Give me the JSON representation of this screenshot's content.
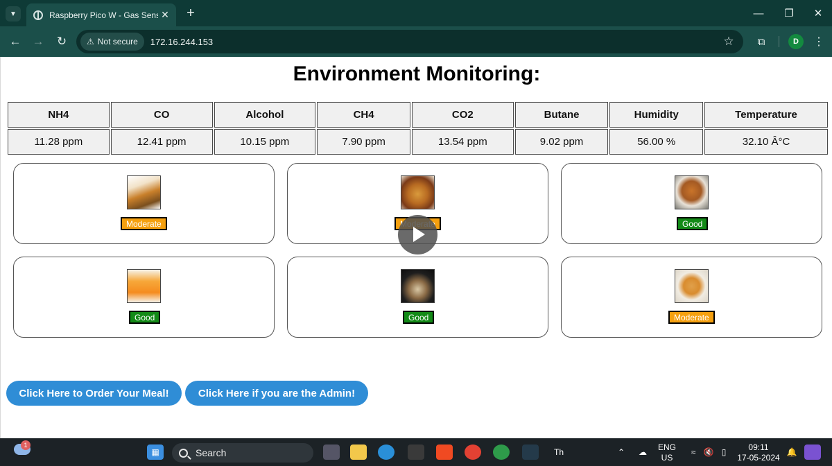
{
  "browser": {
    "tab_title": "Raspberry Pico W - Gas Sensor",
    "security_label": "Not secure",
    "url": "172.16.244.153",
    "profile_initial": "D"
  },
  "page": {
    "heading": "Environment Monitoring:",
    "table": {
      "headers": [
        "NH4",
        "CO",
        "Alcohol",
        "CH4",
        "CO2",
        "Butane",
        "Humidity",
        "Temperature"
      ],
      "values": [
        "11.28 ppm",
        "12.41 ppm",
        "10.15 ppm",
        "7.90 ppm",
        "13.54 ppm",
        "9.02 ppm",
        "56.00 %",
        "32.10 Â°C"
      ]
    },
    "cards": [
      {
        "food": "fried-snack",
        "status": "Moderate",
        "status_color": "#f5a00f"
      },
      {
        "food": "samosa",
        "status": "Moderate",
        "status_color": "#f5a00f"
      },
      {
        "food": "noodles",
        "status": "Good",
        "status_color": "#138a17"
      },
      {
        "food": "orange-juice",
        "status": "Good",
        "status_color": "#138a17"
      },
      {
        "food": "dish",
        "status": "Good",
        "status_color": "#138a17"
      },
      {
        "food": "fries",
        "status": "Moderate",
        "status_color": "#f5a00f"
      }
    ],
    "order_button": "Click Here to Order Your Meal!",
    "admin_button": "Click Here if you are the Admin!"
  },
  "taskbar": {
    "notification_count": "1",
    "search_label": "Search",
    "lang_top": "ENG",
    "lang_bottom": "US",
    "time": "09:11",
    "date": "17-05-2024"
  }
}
